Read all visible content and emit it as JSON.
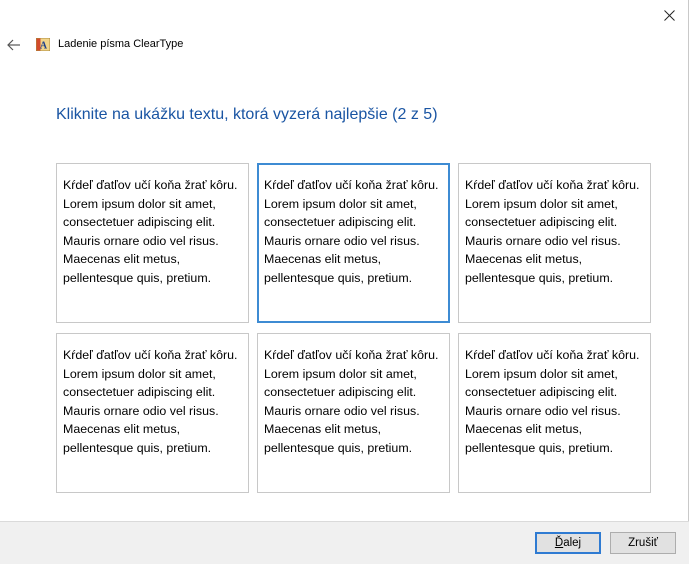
{
  "window": {
    "title": "Ladenie písma ClearType"
  },
  "icons": {
    "close": "close-icon",
    "back": "back-arrow-icon",
    "app": "cleartype-app-icon"
  },
  "instruction": "Kliknite na ukážku textu, ktorá vyzerá najlepšie (2 z 5)",
  "samples": [
    {
      "text": "Kŕdeľ ďatľov učí koňa žrať kôru. Lorem ipsum dolor sit amet, consectetuer adipiscing elit. Mauris ornare odio vel risus. Maecenas elit metus, pellentesque quis, pretium.",
      "selected": false
    },
    {
      "text": "Kŕdeľ ďatľov učí koňa žrať kôru. Lorem ipsum dolor sit amet, consectetuer adipiscing elit. Mauris ornare odio vel risus. Maecenas elit metus, pellentesque quis, pretium.",
      "selected": true
    },
    {
      "text": "Kŕdeľ ďatľov učí koňa žrať kôru. Lorem ipsum dolor sit amet, consectetuer adipiscing elit. Mauris ornare odio vel risus. Maecenas elit metus, pellentesque quis, pretium.",
      "selected": false
    },
    {
      "text": "Kŕdeľ ďatľov učí koňa žrať kôru. Lorem ipsum dolor sit amet, consectetuer adipiscing elit. Mauris ornare odio vel risus. Maecenas elit metus, pellentesque quis, pretium.",
      "selected": false
    },
    {
      "text": "Kŕdeľ ďatľov učí koňa žrať kôru. Lorem ipsum dolor sit amet, consectetuer adipiscing elit. Mauris ornare odio vel risus. Maecenas elit metus, pellentesque quis, pretium.",
      "selected": false
    },
    {
      "text": "Kŕdeľ ďatľov učí koňa žrať kôru. Lorem ipsum dolor sit amet, consectetuer adipiscing elit. Mauris ornare odio vel risus. Maecenas elit metus, pellentesque quis, pretium.",
      "selected": false
    }
  ],
  "buttons": {
    "next_first": "Ď",
    "next_rest": "alej",
    "cancel": "Zrušiť"
  },
  "colors": {
    "instruction": "#1a55a3",
    "selected_border": "#3d8bd3",
    "footer_bg": "#f0f0f0"
  }
}
